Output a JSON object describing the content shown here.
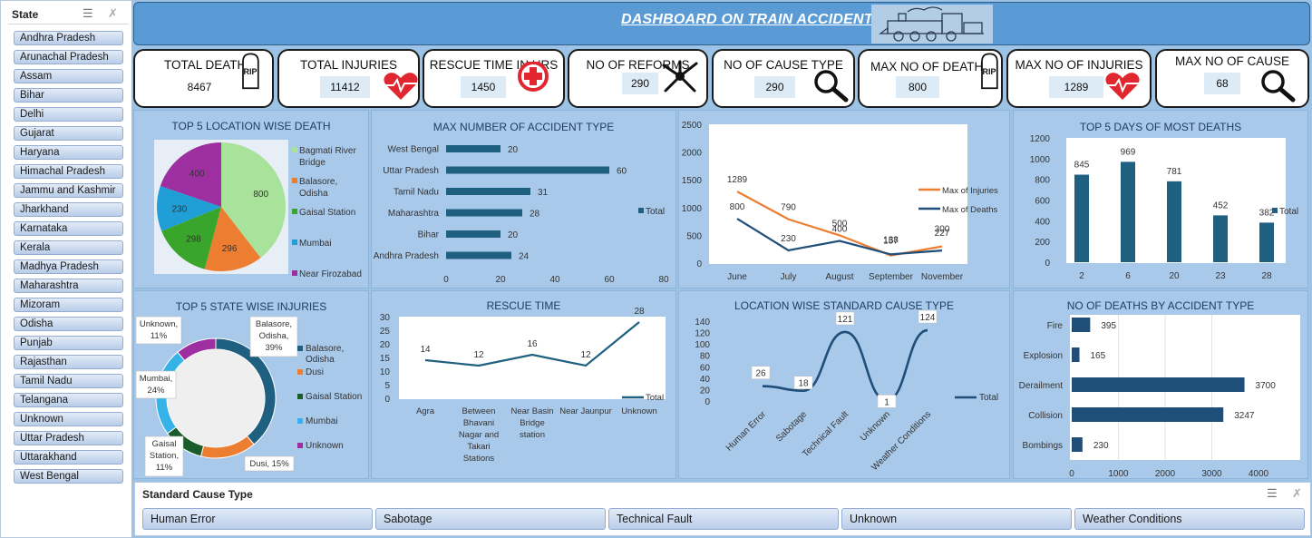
{
  "slicer": {
    "title": "State",
    "items": [
      "Andhra Pradesh",
      "Arunachal Pradesh",
      "Assam",
      "Bihar",
      "Delhi",
      "Gujarat",
      "Haryana",
      "Himachal Pradesh",
      "Jammu and Kashmir",
      "Jharkhand",
      "Karnataka",
      "Kerala",
      "Madhya Pradesh",
      "Maharashtra",
      "Mizoram",
      "Odisha",
      "Punjab",
      "Rajasthan",
      "Tamil Nadu",
      "Telangana",
      "Unknown",
      "Uttar Pradesh",
      "Uttarakhand",
      "West Bengal"
    ],
    "icons": {
      "multiselect": "multi-select-icon",
      "clear": "clear-filter-icon"
    }
  },
  "header": {
    "title": "DASHBOARD ON TRAIN ACCIDENT",
    "image": "train-icon"
  },
  "kpis": [
    {
      "label": "TOTAL DEATH",
      "value": "8467",
      "icon": "rip-tombstone-icon"
    },
    {
      "label": "TOTAL INJURIES",
      "value": "11412",
      "icon": "heartbeat-icon"
    },
    {
      "label": "RESCUE TIME IN HRS",
      "value": "1450",
      "icon": "medical-cross-icon"
    },
    {
      "label": "NO OF REFORMS",
      "value": "290",
      "icon": "hands-icon"
    },
    {
      "label": "NO OF CAUSE TYPE",
      "value": "290",
      "icon": "magnifier-icon"
    },
    {
      "label": "MAX NO OF DEATH",
      "value": "800",
      "icon": "rip-tombstone-icon"
    },
    {
      "label": "MAX NO OF INJURIES",
      "value": "1289",
      "icon": "heartbeat-icon"
    },
    {
      "label": "MAX NO OF CAUSE",
      "value": "68",
      "icon": "magnifier-icon"
    }
  ],
  "colors": {
    "bg": "#9cc3e6",
    "panel": "#a9c9ea",
    "header": "#5b9bd5",
    "bar": "#1f5f7f",
    "orange": "#ed7d31",
    "darkblue": "#1f4e79",
    "pie": [
      "#a9e29a",
      "#ed7d31",
      "#3aa52b",
      "#1f9fd6",
      "#9e2fa0"
    ]
  },
  "chart_data": [
    {
      "type": "pie",
      "title": "TOP 5 LOCATION WISE DEATH",
      "categories": [
        "Bagmati River Bridge",
        "Balasore, Odisha",
        "Gaisal Station",
        "Mumbai",
        "Near Firozabad"
      ],
      "values": [
        800,
        296,
        298,
        230,
        400
      ]
    },
    {
      "type": "bar",
      "orientation": "horizontal",
      "title": "MAX NUMBER OF ACCIDENT TYPE",
      "categories": [
        "West Bengal",
        "Uttar Pradesh",
        "Tamil Nadu",
        "Maharashtra",
        "Bihar",
        "Andhra Pradesh"
      ],
      "values": [
        20,
        60,
        31,
        28,
        20,
        24
      ],
      "xlim": [
        0,
        80
      ],
      "xticks": [
        0,
        20,
        40,
        60,
        80
      ],
      "series": [
        {
          "name": "Total",
          "values": [
            20,
            60,
            31,
            28,
            20,
            24
          ]
        }
      ]
    },
    {
      "type": "line",
      "title": "",
      "categories": [
        "June",
        "July",
        "August",
        "September",
        "November"
      ],
      "series": [
        {
          "name": "Max of Injuries",
          "values": [
            1289,
            790,
            500,
            138,
            300
          ]
        },
        {
          "name": "Max of Deaths",
          "values": [
            800,
            230,
            400,
            157,
            227
          ]
        }
      ],
      "ylim": [
        0,
        2500
      ],
      "yticks": [
        0,
        500,
        1000,
        1500,
        2000,
        2500
      ]
    },
    {
      "type": "bar",
      "title": "TOP 5 DAYS OF MOST DEATHS",
      "categories": [
        "2",
        "6",
        "20",
        "23",
        "28"
      ],
      "values": [
        845,
        969,
        781,
        452,
        382
      ],
      "ylim": [
        0,
        1200
      ],
      "yticks": [
        0,
        200,
        400,
        600,
        800,
        1000,
        1200
      ],
      "series": [
        {
          "name": "Total",
          "values": [
            845,
            969,
            781,
            452,
            382
          ]
        }
      ]
    },
    {
      "type": "pie",
      "subtype": "donut",
      "title": "TOP 5 STATE WISE INJURIES",
      "categories": [
        "Balasore, Odisha",
        "Dusi",
        "Gaisal Station",
        "Mumbai",
        "Unknown"
      ],
      "values": [
        39,
        15,
        11,
        24,
        11
      ],
      "labels": [
        "Balasore, Odisha, 39%",
        "Dusi, 15%",
        "Gaisal Station, 11%",
        "Mumbai, 24%",
        "Unknown, 11%"
      ]
    },
    {
      "type": "line",
      "title": "RESCUE TIME",
      "categories": [
        "Agra",
        "Between Bhavani Nagar and Takari Stations",
        "Near Basin Bridge station",
        "Near Jaunpur",
        "Unknown"
      ],
      "values": [
        14,
        12,
        16,
        12,
        28
      ],
      "ylim": [
        0,
        30
      ],
      "yticks": [
        0,
        5,
        10,
        15,
        20,
        25,
        30
      ],
      "series": [
        {
          "name": "Total",
          "values": [
            14,
            12,
            16,
            12,
            28
          ]
        }
      ]
    },
    {
      "type": "line",
      "title": "LOCATION WISE STANDARD CAUSE TYPE",
      "categories": [
        "Human Error",
        "Sabotage",
        "Technical Fault",
        "Unknown",
        "Weather Conditions"
      ],
      "values": [
        26,
        18,
        121,
        1,
        124
      ],
      "ylim": [
        0,
        140
      ],
      "yticks": [
        0,
        20,
        40,
        60,
        80,
        100,
        120,
        140
      ],
      "series": [
        {
          "name": "Total",
          "values": [
            26,
            18,
            121,
            1,
            124
          ]
        }
      ]
    },
    {
      "type": "bar",
      "orientation": "horizontal",
      "title": "NO OF DEATHS  BY ACCIDENT TYPE",
      "categories": [
        "Fire",
        "Explosion",
        "Derailment",
        "Collision",
        "Bombings"
      ],
      "values": [
        395,
        165,
        3700,
        3247,
        230
      ],
      "xlim": [
        0,
        4000
      ],
      "xticks": [
        0,
        1000,
        2000,
        3000,
        4000
      ]
    }
  ],
  "bottom_slicer": {
    "title": "Standard Cause Type",
    "items": [
      "Human Error",
      "Sabotage",
      "Technical Fault",
      "Unknown",
      "Weather Conditions"
    ]
  }
}
